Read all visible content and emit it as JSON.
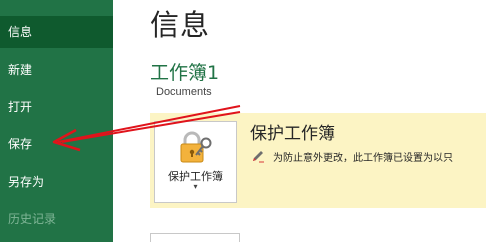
{
  "sidebar": {
    "items": [
      {
        "label": "信息"
      },
      {
        "label": "新建"
      },
      {
        "label": "打开"
      },
      {
        "label": "保存"
      },
      {
        "label": "另存为"
      },
      {
        "label": "历史记录"
      }
    ]
  },
  "main": {
    "title": "信息",
    "workbook_name": "工作簿1",
    "workbook_path": "Documents",
    "protect": {
      "button_label": "保护工作簿",
      "button_caret": "▾",
      "button_icon": "lock-key-icon",
      "heading": "保护工作簿",
      "description_icon": "pen-icon",
      "description": "为防止意外更改，此工作簿已设置为以只"
    }
  },
  "colors": {
    "sidebar_bg": "#217346",
    "sidebar_active_bg": "#0f5a2e",
    "accent_green": "#217346",
    "protect_bg": "#fcf4c4",
    "annotation_red": "#e0131b"
  }
}
